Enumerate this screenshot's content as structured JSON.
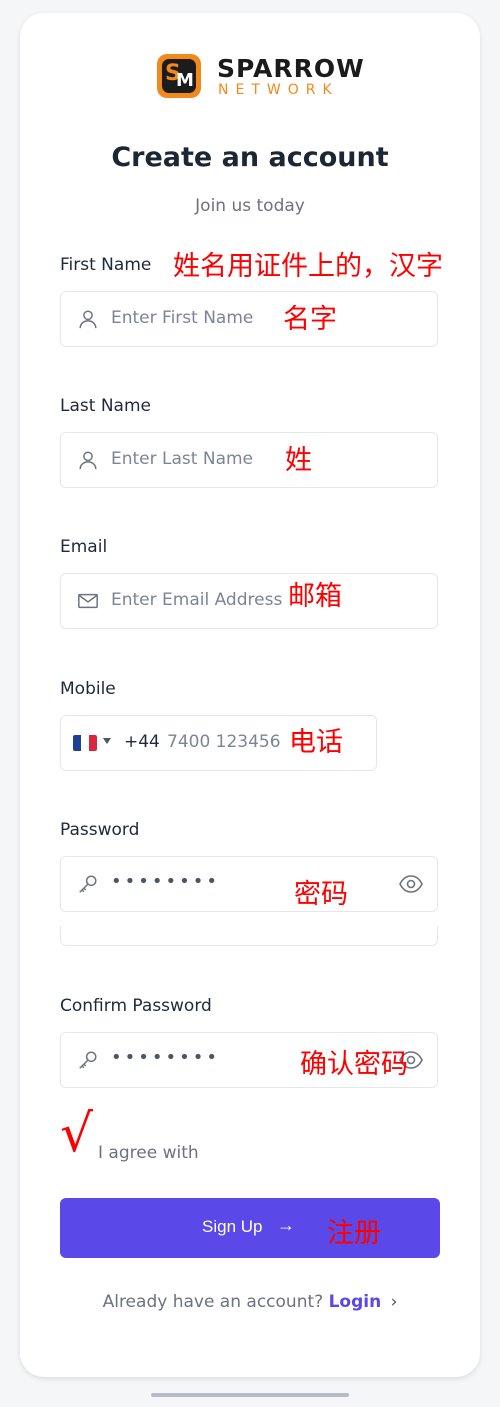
{
  "brand": {
    "name": "SPARROW",
    "tagline": "NETWORK",
    "accent": "#f08a1d"
  },
  "heading": "Create an account",
  "subheading": "Join us today",
  "fields": {
    "first_name": {
      "label": "First Name",
      "placeholder": "Enter First Name",
      "icon": "user-icon",
      "annotation": "名字"
    },
    "last_name": {
      "label": "Last Name",
      "placeholder": "Enter Last Name",
      "icon": "user-icon",
      "annotation": "姓"
    },
    "email": {
      "label": "Email",
      "placeholder": "Enter Email Address",
      "icon": "mail-icon",
      "annotation": "邮箱"
    },
    "mobile": {
      "label": "Mobile",
      "dial_code": "+44",
      "placeholder": "7400 123456",
      "flag": "flag-icon",
      "annotation": "电话"
    },
    "password": {
      "label": "Password",
      "value": "••••••••",
      "icon": "key-icon",
      "annotation": "密码"
    },
    "confirm_password": {
      "label": "Confirm Password",
      "value": "••••••••",
      "icon": "key-icon",
      "annotation": "确认密码"
    }
  },
  "annotations": {
    "name_note": "姓名用证件上的，汉字",
    "check": "√",
    "signup_note": "注册"
  },
  "agree": {
    "label": "I agree with"
  },
  "signup": {
    "label": "Sign Up",
    "arrow": "→",
    "color": "#5a48e8"
  },
  "login_prompt": {
    "text": "Already have an account?",
    "link": "Login",
    "chevron": "›"
  }
}
